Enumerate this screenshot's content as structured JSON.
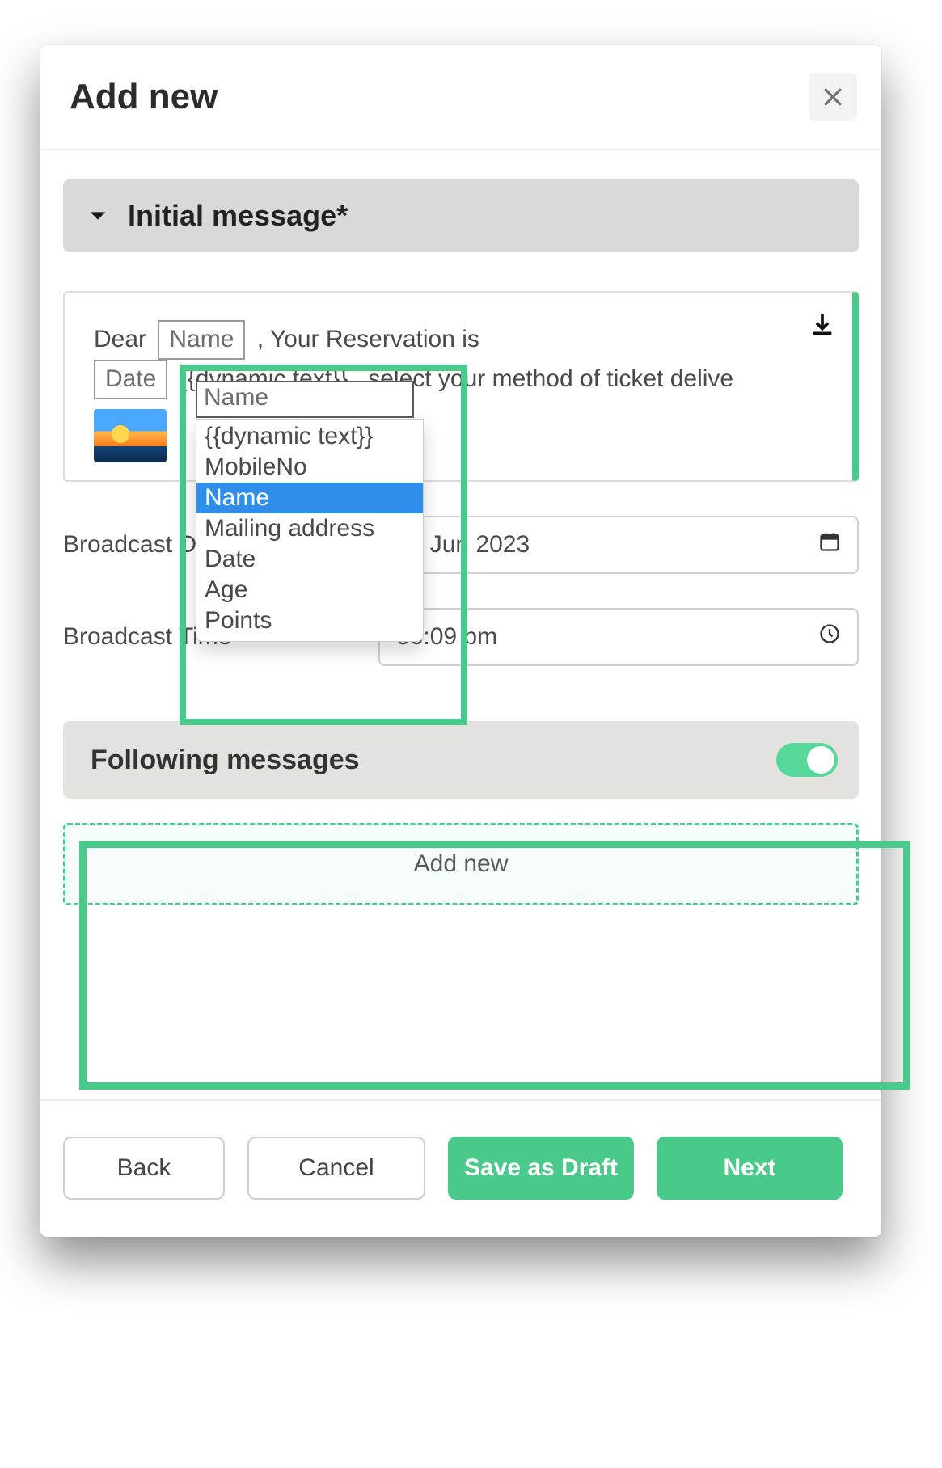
{
  "header": {
    "title": "Add new"
  },
  "accordion": {
    "initial_message_label": "Initial message*"
  },
  "message": {
    "prefix": "Dear",
    "name_field_value": "Name",
    "mid1": ", Your Reservation is",
    "date_field_value": "Date",
    "mid2": "select your method of ticket delive"
  },
  "dropdown": {
    "search_value": "Name",
    "items": [
      "{{dynamic text}}",
      "MobileNo",
      "Name",
      "Mailing address",
      "Date",
      "Age",
      "Points"
    ],
    "selected_index": 2
  },
  "form": {
    "broadcast_date_label": "Broadcast Date*",
    "broadcast_date_value": "08 Jun 2023",
    "broadcast_time_label": "Broadcast Time*",
    "broadcast_time_value": "06:09 pm"
  },
  "following": {
    "title": "Following messages",
    "toggle_on": true,
    "add_new_label": "Add new"
  },
  "footer": {
    "back": "Back",
    "cancel": "Cancel",
    "save_draft": "Save as Draft",
    "next": "Next"
  }
}
